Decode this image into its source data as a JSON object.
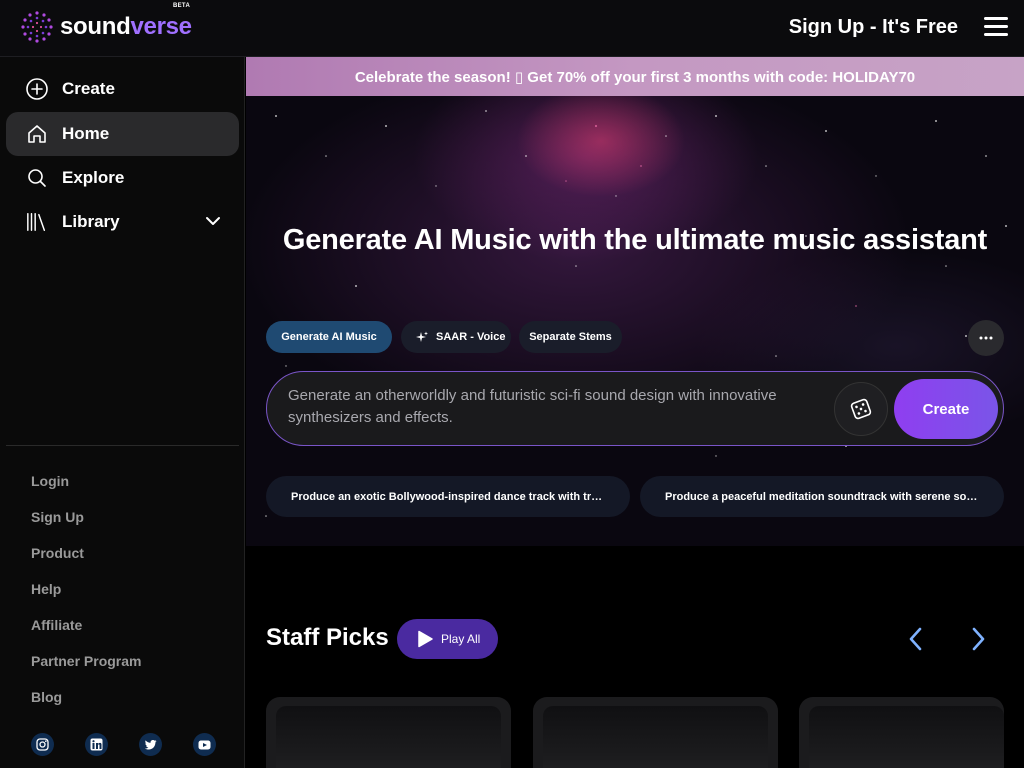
{
  "brand": {
    "name_part1": "sound",
    "name_part2": "verse",
    "badge": "BETA"
  },
  "header": {
    "signup_label": "Sign Up - It's Free",
    "menu_icon": "hamburger-icon"
  },
  "sidebar": {
    "nav": [
      {
        "label": "Create",
        "icon": "plus-circle-icon"
      },
      {
        "label": "Home",
        "icon": "home-icon",
        "active": true
      },
      {
        "label": "Explore",
        "icon": "search-icon"
      },
      {
        "label": "Library",
        "icon": "library-icon",
        "expandable": true
      }
    ],
    "links": [
      "Login",
      "Sign Up",
      "Product",
      "Help",
      "Affiliate",
      "Partner Program",
      "Blog"
    ],
    "socials": [
      "instagram-icon",
      "linkedin-icon",
      "twitter-icon",
      "youtube-icon"
    ]
  },
  "promo": {
    "text": "Celebrate the season! ▯ Get 70% off your first 3 months with code: HOLIDAY70"
  },
  "hero": {
    "title": "Generate AI Music with the ultimate music assistant",
    "modes": [
      "Generate AI Music",
      "SAAR - Voice",
      "Separate Stems"
    ],
    "prompt_placeholder": "Generate an otherworldly and futuristic sci-fi sound design with innovative synthesizers and effects.",
    "create_label": "Create",
    "suggestions": [
      "Produce an exotic Bollywood-inspired dance track with traditional instruments",
      "Produce a peaceful meditation soundtrack with serene sounds of nature"
    ]
  },
  "staff_picks": {
    "title": "Staff Picks",
    "play_all_label": "Play All"
  },
  "colors": {
    "accent": "#8f3ef0",
    "promo_bg": "#c498c2",
    "active_chip": "#1f4a72"
  }
}
